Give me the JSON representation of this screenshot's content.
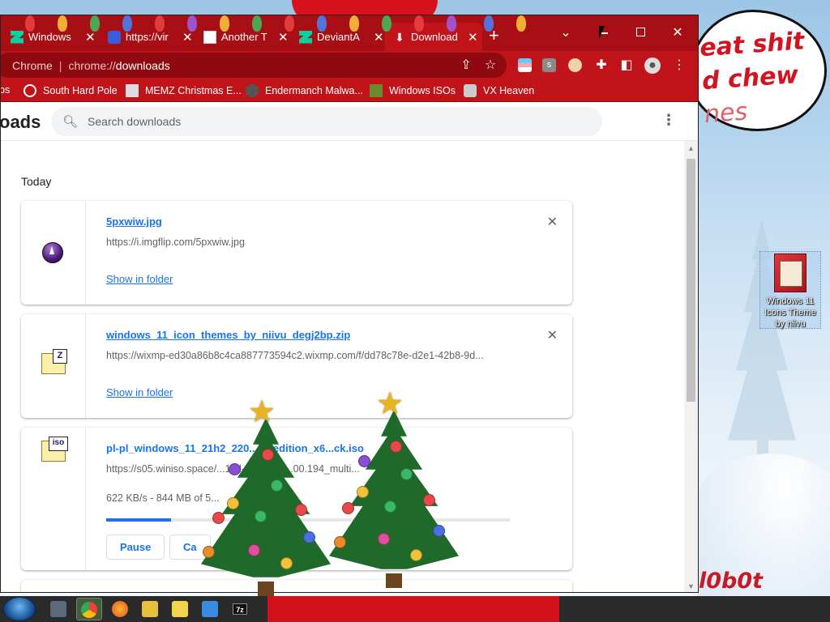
{
  "desktop": {
    "speech_bubble_lines": [
      "eat shit",
      "d chew",
      "nes"
    ],
    "signature": "l0b0t",
    "icon_label": "Windows 11 Icons Theme by niivu"
  },
  "tabs": [
    {
      "title": "Windows",
      "favicon": "deviantart-icon"
    },
    {
      "title": "https://vir",
      "favicon": "virustotal-icon"
    },
    {
      "title": "Another T",
      "favicon": "gmail-icon"
    },
    {
      "title": "DeviantA",
      "favicon": "deviantart-icon"
    },
    {
      "title": "Download",
      "favicon": "download-icon",
      "active": true
    }
  ],
  "omnibox": {
    "site_label": "Chrome",
    "url_scheme": "chrome://",
    "url_host": "downloads"
  },
  "bookmarks": [
    {
      "label": "bs"
    },
    {
      "label": "South Hard Pole"
    },
    {
      "label": "MEMZ Christmas E..."
    },
    {
      "label": "Endermanch Malwa..."
    },
    {
      "label": "Windows ISOs"
    },
    {
      "label": "VX Heaven"
    }
  ],
  "downloads_page": {
    "title": "oads",
    "search_placeholder": "Search downloads",
    "date_group": "Today",
    "items": [
      {
        "file_name": "5pxwiw.jpg",
        "url": "https://i.imgflip.com/5pxwiw.jpg",
        "action": "Show in folder"
      },
      {
        "file_name": "windows_11_icon_themes_by_niivu_degj2bp.zip",
        "url": "https://wixmp-ed30a86b8c4ca887773594c2.wixmp.com/f/dd78c78e-d2e1-42b8-9d...",
        "action": "Show in folder"
      },
      {
        "file_name": "pl-pl_windows_11_21h2_220...lti_edition_x6...ck.iso",
        "url": "https://s05.winiso.space/...1/pl-pl_windo...00.194_multi...",
        "status": "622 KB/s - 844 MB of 5...",
        "progress": 0.16,
        "pause_label": "Pause",
        "cancel_label": "Ca"
      }
    ]
  },
  "colors": {
    "chrome_frame": "#a80f14",
    "chrome_toolbar": "#c1141a",
    "link_blue": "#1a73e8",
    "desktop_red": "#d6121c"
  }
}
